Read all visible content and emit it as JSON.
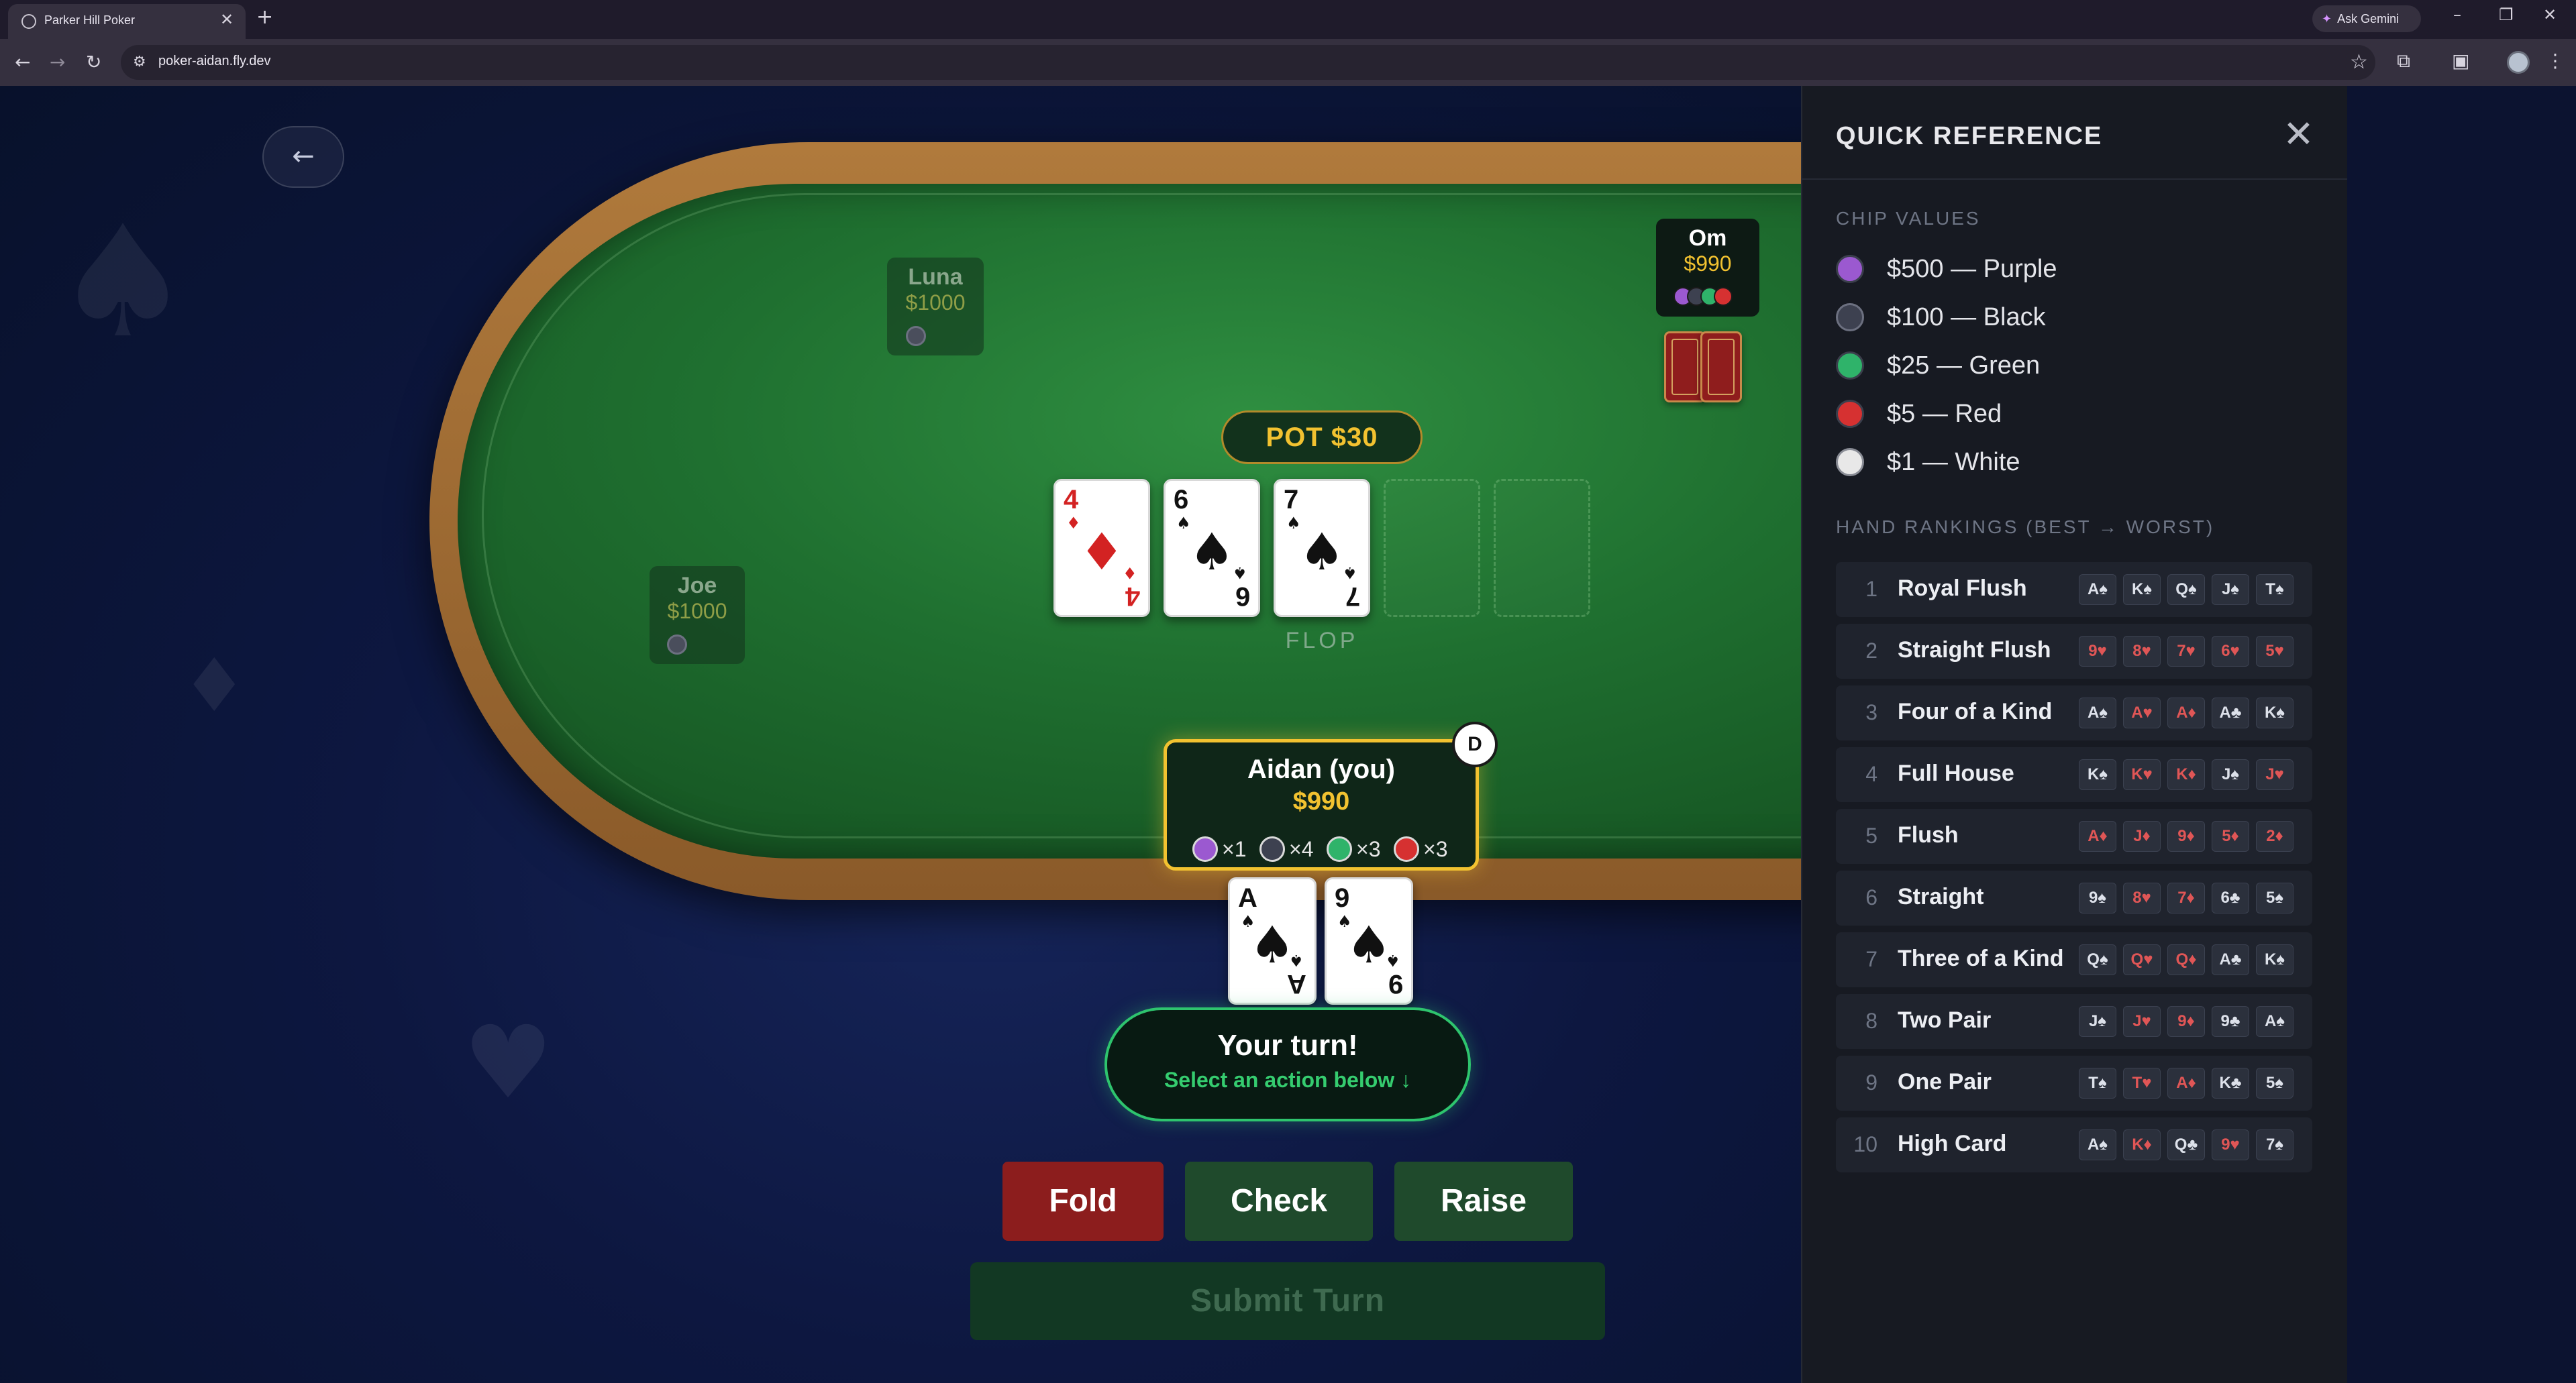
{
  "browser": {
    "tab_title": "Parker Hill Poker",
    "tab_close": "✕",
    "new_tab": "+",
    "gemini_label": "Ask Gemini",
    "url": "poker-aidan.fly.dev",
    "icons": [
      "back-arrow-icon",
      "forward-arrow-icon",
      "reload-icon",
      "site-info-icon",
      "bookmark-star-icon",
      "extensions-icon",
      "tab-search-icon",
      "profile-icon",
      "menu-dots-icon"
    ]
  },
  "game": {
    "back_label": "←",
    "pot_label": "POT $30",
    "street_label": "FLOP",
    "players": {
      "luna": {
        "name": "Luna",
        "stack": "$1000"
      },
      "joe": {
        "name": "Joe",
        "stack": "$1000"
      },
      "om": {
        "name": "Om",
        "stack": "$990"
      }
    },
    "hero": {
      "name": "Aidan (you)",
      "stack": "$990",
      "dealer_button": "D",
      "chips": [
        {
          "color": "#9b59d0",
          "count": "×1"
        },
        {
          "color": "#3d4150",
          "count": "×4"
        },
        {
          "color": "#2fb36a",
          "count": "×3"
        },
        {
          "color": "#d63131",
          "count": "×3"
        }
      ],
      "hole_cards": [
        {
          "rank": "A",
          "suit": "♠",
          "color": "black"
        },
        {
          "rank": "9",
          "suit": "♠",
          "color": "black"
        }
      ]
    },
    "board": [
      {
        "rank": "4",
        "suit": "♦",
        "color": "red"
      },
      {
        "rank": "6",
        "suit": "♠",
        "color": "black"
      },
      {
        "rank": "7",
        "suit": "♠",
        "color": "black"
      }
    ],
    "turn_title": "Your turn!",
    "turn_subtitle": "Select an action below ↓",
    "actions": {
      "fold": "Fold",
      "check": "Check",
      "raise": "Raise",
      "submit": "Submit Turn"
    },
    "help_label": "?",
    "colors": {
      "felt": "#1f7030",
      "rail": "#a06d34",
      "gold": "#f2c230",
      "fold": "#8c1d1d",
      "action": "#1f4a2c"
    }
  },
  "reference": {
    "title": "QUICK REFERENCE",
    "close": "✕",
    "chip_heading": "CHIP VALUES",
    "chips": [
      {
        "label": "$500 — Purple",
        "color": "#9b59d0"
      },
      {
        "label": "$100 — Black",
        "color": "#3d4150"
      },
      {
        "label": "$25 — Green",
        "color": "#2fb36a"
      },
      {
        "label": "$5 — Red",
        "color": "#d63131"
      },
      {
        "label": "$1 — White",
        "color": "#e8e8e8"
      }
    ],
    "rank_heading": "HAND RANKINGS (BEST → WORST)",
    "rankings": [
      {
        "num": "1",
        "name": "Royal Flush",
        "cards": [
          [
            "A♠",
            "b"
          ],
          [
            "K♠",
            "b"
          ],
          [
            "Q♠",
            "b"
          ],
          [
            "J♠",
            "b"
          ],
          [
            "T♠",
            "b"
          ]
        ]
      },
      {
        "num": "2",
        "name": "Straight Flush",
        "cards": [
          [
            "9♥",
            "r"
          ],
          [
            "8♥",
            "r"
          ],
          [
            "7♥",
            "r"
          ],
          [
            "6♥",
            "r"
          ],
          [
            "5♥",
            "r"
          ]
        ]
      },
      {
        "num": "3",
        "name": "Four of a Kind",
        "cards": [
          [
            "A♠",
            "b"
          ],
          [
            "A♥",
            "r"
          ],
          [
            "A♦",
            "r"
          ],
          [
            "A♣",
            "b"
          ],
          [
            "K♠",
            "b"
          ]
        ]
      },
      {
        "num": "4",
        "name": "Full House",
        "cards": [
          [
            "K♠",
            "b"
          ],
          [
            "K♥",
            "r"
          ],
          [
            "K♦",
            "r"
          ],
          [
            "J♠",
            "b"
          ],
          [
            "J♥",
            "r"
          ]
        ]
      },
      {
        "num": "5",
        "name": "Flush",
        "cards": [
          [
            "A♦",
            "r"
          ],
          [
            "J♦",
            "r"
          ],
          [
            "9♦",
            "r"
          ],
          [
            "5♦",
            "r"
          ],
          [
            "2♦",
            "r"
          ]
        ]
      },
      {
        "num": "6",
        "name": "Straight",
        "cards": [
          [
            "9♠",
            "b"
          ],
          [
            "8♥",
            "r"
          ],
          [
            "7♦",
            "r"
          ],
          [
            "6♣",
            "b"
          ],
          [
            "5♠",
            "b"
          ]
        ]
      },
      {
        "num": "7",
        "name": "Three of a Kind",
        "cards": [
          [
            "Q♠",
            "b"
          ],
          [
            "Q♥",
            "r"
          ],
          [
            "Q♦",
            "r"
          ],
          [
            "A♣",
            "b"
          ],
          [
            "K♠",
            "b"
          ]
        ]
      },
      {
        "num": "8",
        "name": "Two Pair",
        "cards": [
          [
            "J♠",
            "b"
          ],
          [
            "J♥",
            "r"
          ],
          [
            "9♦",
            "r"
          ],
          [
            "9♣",
            "b"
          ],
          [
            "A♠",
            "b"
          ]
        ]
      },
      {
        "num": "9",
        "name": "One Pair",
        "cards": [
          [
            "T♠",
            "b"
          ],
          [
            "T♥",
            "r"
          ],
          [
            "A♦",
            "r"
          ],
          [
            "K♣",
            "b"
          ],
          [
            "5♠",
            "b"
          ]
        ]
      },
      {
        "num": "10",
        "name": "High Card",
        "cards": [
          [
            "A♠",
            "b"
          ],
          [
            "K♦",
            "r"
          ],
          [
            "Q♣",
            "b"
          ],
          [
            "9♥",
            "r"
          ],
          [
            "7♠",
            "b"
          ]
        ]
      }
    ]
  }
}
